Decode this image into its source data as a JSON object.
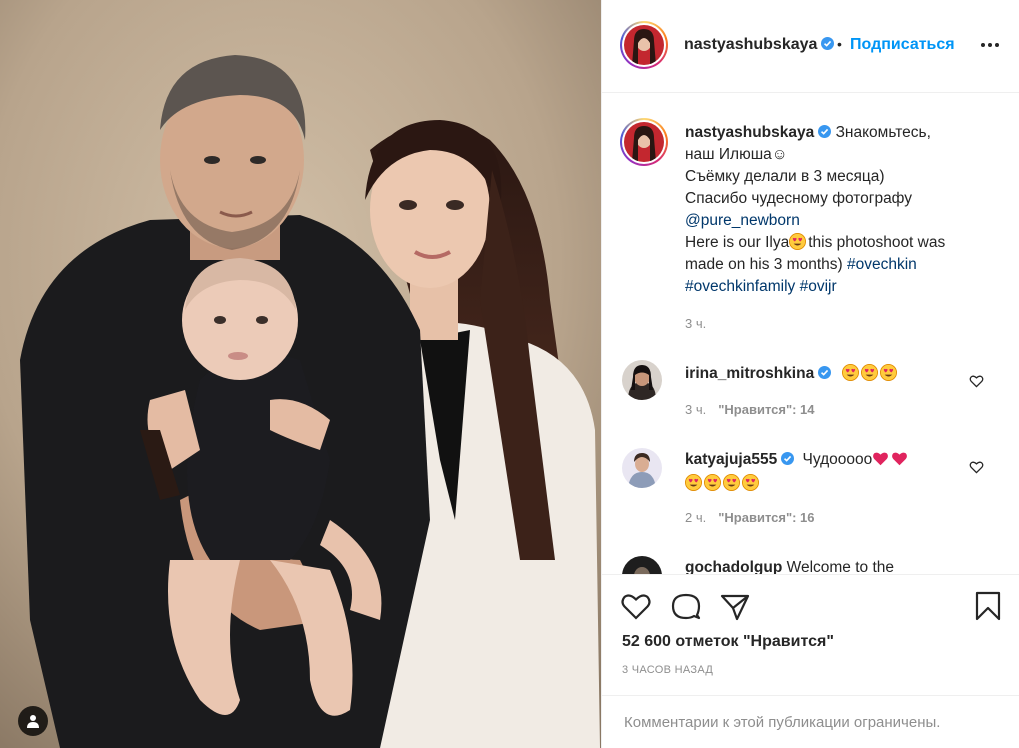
{
  "post": {
    "username": "nastyashubskaya",
    "dot": "•",
    "follow_label": "Подписаться",
    "caption": {
      "username": "nastyashubskaya",
      "line1": "Знакомьтесь,",
      "line2": "наш Илюша☺",
      "line3": "Съёмку делали в 3 месяца)",
      "line4": "Спасибо чудесному фотографу",
      "mention": "@pure_newborn",
      "line5a": "Here is our Ilya",
      "line5b": "this photoshoot was",
      "line6a": "made on his 3 months)",
      "hashtag1": "#ovechkin",
      "hashtag2": "#ovechkinfamily",
      "hashtag3": "#ovijr",
      "time": "3 ч."
    },
    "comments": [
      {
        "username": "irina_mitroshkina",
        "text": "",
        "emojis": [
          "heart-eyes",
          "heart-eyes",
          "heart-eyes"
        ],
        "time": "3 ч.",
        "likes": "\"Нравится\": 14"
      },
      {
        "username": "katyajuja555",
        "text": "Чудооооо",
        "emojis": [
          "heart",
          "heart",
          "heart-eyes",
          "heart-eyes",
          "heart-eyes",
          "heart-eyes"
        ],
        "time": "2 ч.",
        "likes": "\"Нравится\": 16"
      },
      {
        "username": "gochadolgup",
        "text": "Welcome to the"
      }
    ],
    "likes_count": "52 600 отметок \"Нравится\"",
    "timestamp": "3 ЧАСОВ НАЗАД",
    "comments_limited": "Комментарии к этой публикации ограничены."
  },
  "colors": {
    "accent": "#0095f6",
    "link": "#00376b",
    "muted": "#8e8e8e",
    "text": "#262626",
    "border": "#efefef"
  },
  "icons": [
    "verified-icon",
    "more-options-icon",
    "like-heart-icon",
    "comment-icon",
    "share-icon",
    "save-bookmark-icon",
    "tag-person-icon"
  ]
}
